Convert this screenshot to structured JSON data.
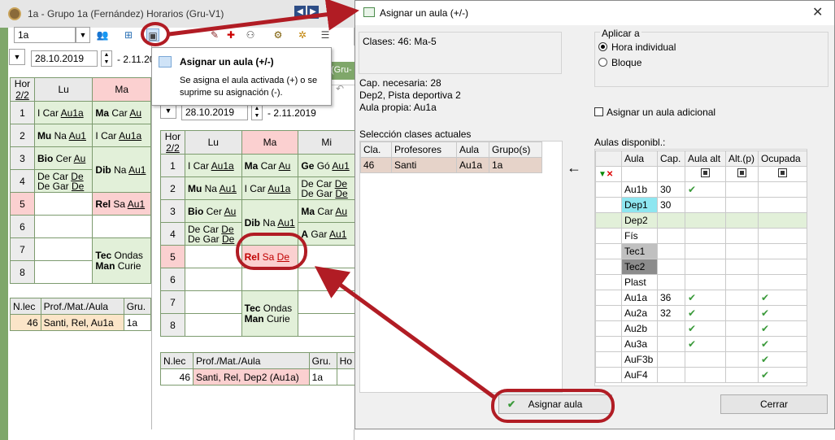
{
  "win1": {
    "title": "1a - Grupo 1a (Fernández)  Horarios  (Gru-V1)",
    "class_select": "1a",
    "date_from": "28.10.2019",
    "date_to": "- 2.11.2019",
    "col_period": "Hor",
    "col_period2": "2/2",
    "days": [
      "Lu",
      "Ma"
    ],
    "cells": {
      "r1_lu": [
        "I Car ",
        "Au1a"
      ],
      "r1_ma": [
        "Ma",
        " Car ",
        "Au"
      ],
      "r2_lu": [
        "Mu",
        " Na ",
        "Au1"
      ],
      "r2_ma": [
        "I Car ",
        "Au1a"
      ],
      "r3_lu": [
        "Bio",
        " Cer ",
        "Au"
      ],
      "r4_lu_a": [
        "De Car ",
        "De"
      ],
      "r4_lu_b": [
        "De Gar ",
        "De"
      ],
      "r34_ma": [
        "Dib",
        " Na ",
        "Au1"
      ],
      "r5_ma": [
        "Rel",
        " Sa ",
        "Au1"
      ],
      "r78_ma_a": [
        "Tec",
        "  Ondas"
      ],
      "r78_ma_b": [
        "Man",
        " Curie"
      ]
    },
    "periods": [
      "1",
      "2",
      "3",
      "4",
      "5",
      "6",
      "7",
      "8"
    ],
    "bottom": {
      "h1": "N.lec",
      "h2": "Prof./Mat./Aula",
      "h3": "Gru.",
      "v1": "46",
      "v2": "Santi, Rel, Au1a",
      "v3": "1a"
    }
  },
  "tooltip": {
    "title": "Asignar un aula (+/-)",
    "body": "Se asigna el aula activada (+) o se suprime su asignación (-)."
  },
  "win2": {
    "tag": "(Gru-",
    "date_from": "28.10.2019",
    "date_to": "- 2.11.2019",
    "col_period": "Hor",
    "col_period2": "2/2",
    "days": [
      "Lu",
      "Ma",
      "Mi"
    ],
    "periods": [
      "1",
      "2",
      "3",
      "4",
      "5",
      "6",
      "7",
      "8"
    ],
    "cells": {
      "r1_lu": [
        "I Car ",
        "Au1a"
      ],
      "r1_ma": [
        "Ma",
        " Car ",
        "Au"
      ],
      "r1_mi": [
        "Ge",
        " Gó ",
        "Au1"
      ],
      "r2_lu": [
        "Mu",
        " Na ",
        "Au1"
      ],
      "r2_ma": [
        "I Car ",
        "Au1a"
      ],
      "r2_mi_a": [
        "De Car ",
        "De"
      ],
      "r2_mi_b": [
        "De Gar ",
        "De"
      ],
      "r3_lu": [
        "Bio",
        " Cer ",
        "Au"
      ],
      "r3_mi": [
        "Ma",
        " Car ",
        "Au"
      ],
      "r4_lu_a": [
        "De Car ",
        "De"
      ],
      "r4_lu_b": [
        "De Gar ",
        "De"
      ],
      "r34_ma": [
        "Dib",
        " Na ",
        "Au1"
      ],
      "r4_mi": [
        "A",
        " Gar ",
        "Au1"
      ],
      "r5_ma": [
        "Rel",
        " Sa ",
        "De"
      ],
      "r78_ma_a": [
        "Tec",
        "  Ondas"
      ],
      "r78_ma_b": [
        "Man",
        " Curie"
      ]
    },
    "bottom": {
      "h1": "N.lec",
      "h2": "Prof./Mat./Aula",
      "h3": "Gru.",
      "h4": "Ho",
      "v1": "46",
      "v2": "Santi, Rel, Dep2 (Au1a)",
      "v3": "1a"
    }
  },
  "dialog": {
    "title": "Asignar un aula (+/-)",
    "clases": "Clases: 46: Ma-5",
    "apply_group": "Aplicar a",
    "radio1": "Hora individual",
    "radio2": "Bloque",
    "cap_necesaria": "Cap. necesaria: 28",
    "dep2": "Dep2, Pista deportiva 2",
    "aula_propia": "Aula propia: Au1a",
    "checkbox_adicional": "Asignar un aula adicional",
    "sel_title": "Selección clases actuales",
    "sel_headers": [
      "Cla.",
      "Profesores",
      "Aula",
      "Grupo(s)"
    ],
    "sel_row": [
      "46",
      "Santi",
      "Au1a",
      "1a"
    ],
    "aulas_title": "Aulas disponibl.:",
    "aulas_headers": [
      "Aula",
      "Cap.",
      "Aula alt",
      "Alt.(p)",
      "Ocupada"
    ],
    "aulas": [
      {
        "name": "Au1b",
        "cap": "30",
        "alt": true,
        "occ": false,
        "color": "#ffffff"
      },
      {
        "name": "Dep1",
        "cap": "30",
        "alt": false,
        "occ": false,
        "color": "#8ee6f0"
      },
      {
        "name": "Dep2",
        "cap": "",
        "alt": false,
        "occ": false,
        "color": "#e2f0d9",
        "row": "#e2f0d9"
      },
      {
        "name": "Fís",
        "cap": "",
        "alt": false,
        "occ": false,
        "color": "#ffffff"
      },
      {
        "name": "Tec1",
        "cap": "",
        "alt": false,
        "occ": false,
        "color": "#c0c0c0"
      },
      {
        "name": "Tec2",
        "cap": "",
        "alt": false,
        "occ": false,
        "color": "#8c8c8c"
      },
      {
        "name": "Plast",
        "cap": "",
        "alt": false,
        "occ": false,
        "color": "#ffffff"
      },
      {
        "name": "Au1a",
        "cap": "36",
        "alt": true,
        "occ": true,
        "color": "#ffffff"
      },
      {
        "name": "Au2a",
        "cap": "32",
        "alt": true,
        "occ": true,
        "color": "#ffffff"
      },
      {
        "name": "Au2b",
        "cap": "",
        "alt": true,
        "occ": true,
        "color": "#ffffff"
      },
      {
        "name": "Au3a",
        "cap": "",
        "alt": true,
        "occ": true,
        "color": "#ffffff"
      },
      {
        "name": "AuF3b",
        "cap": "",
        "alt": false,
        "occ": true,
        "color": "#ffffff"
      },
      {
        "name": "AuF4",
        "cap": "",
        "alt": false,
        "occ": true,
        "color": "#ffffff"
      }
    ],
    "btn_assign": "Asignar aula",
    "btn_close": "Cerrar",
    "check_glyph": "✔"
  }
}
